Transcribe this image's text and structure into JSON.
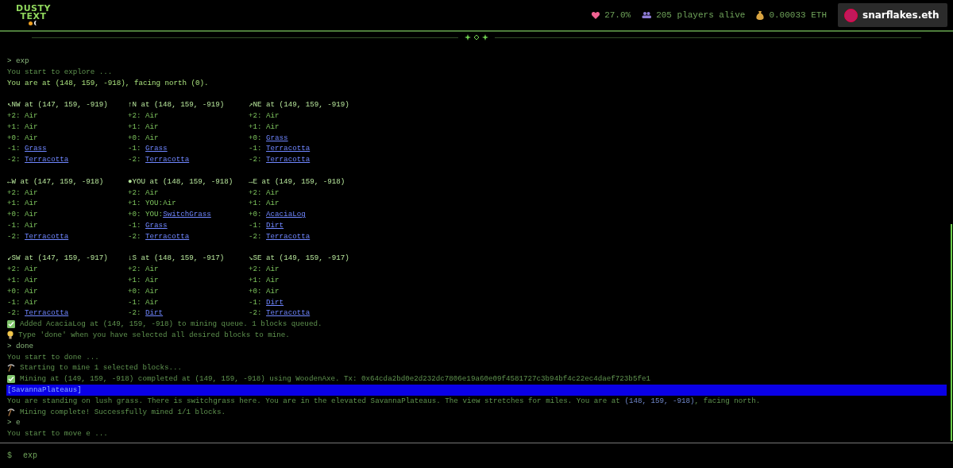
{
  "header": {
    "logo": {
      "line1": "DUSTY",
      "line2": "TEXT"
    },
    "stats": [
      {
        "kind": "health",
        "text": "27.0%"
      },
      {
        "kind": "players",
        "text": "205 players alive"
      },
      {
        "kind": "balance",
        "text": "0.00033 ETH"
      }
    ],
    "account": {
      "name": "snarflakes.eth"
    }
  },
  "log": [
    {
      "kind": "command",
      "text": "> exp"
    },
    {
      "kind": "info",
      "text": "You start to explore ..."
    },
    {
      "kind": "highlight",
      "text": "You are at (148, 159, -918), facing north (0)."
    },
    {
      "kind": "grid",
      "cells": [
        {
          "heading": "↖NW at (147, 159, -919)",
          "rows": [
            {
              "label": "+2:",
              "block": "Air",
              "link": false
            },
            {
              "label": "+1:",
              "block": "Air",
              "link": false
            },
            {
              "label": "+0:",
              "block": "Air",
              "link": false
            },
            {
              "label": "-1:",
              "block": "Grass",
              "link": true
            },
            {
              "label": "-2:",
              "block": "Terracotta",
              "link": true
            }
          ]
        },
        {
          "heading": "↑N at (148, 159, -919)",
          "rows": [
            {
              "label": "+2:",
              "block": "Air",
              "link": false
            },
            {
              "label": "+1:",
              "block": "Air",
              "link": false
            },
            {
              "label": "+0:",
              "block": "Air",
              "link": false
            },
            {
              "label": "-1:",
              "block": "Grass",
              "link": true
            },
            {
              "label": "-2:",
              "block": "Terracotta",
              "link": true
            }
          ]
        },
        {
          "heading": "↗NE at (149, 159, -919)",
          "rows": [
            {
              "label": "+2:",
              "block": "Air",
              "link": false
            },
            {
              "label": "+1:",
              "block": "Air",
              "link": false
            },
            {
              "label": "+0:",
              "block": "Grass",
              "link": true
            },
            {
              "label": "-1:",
              "block": "Terracotta",
              "link": true
            },
            {
              "label": "-2:",
              "block": "Terracotta",
              "link": true
            }
          ]
        },
        {
          "heading": "←W at (147, 159, -918)",
          "rows": [
            {
              "label": "+2:",
              "block": "Air",
              "link": false
            },
            {
              "label": "+1:",
              "block": "Air",
              "link": false
            },
            {
              "label": "+0:",
              "block": "Air",
              "link": false
            },
            {
              "label": "-1:",
              "block": "Air",
              "link": false
            },
            {
              "label": "-2:",
              "block": "Terracotta",
              "link": true
            }
          ]
        },
        {
          "heading": "●YOU at (148, 159, -918)",
          "rows": [
            {
              "label": "+2:",
              "block": "Air",
              "link": false
            },
            {
              "label": "+1:",
              "prefix": "YOU:",
              "block": "Air",
              "link": false
            },
            {
              "label": "+0:",
              "prefix": "YOU:",
              "block": "SwitchGrass",
              "link": true
            },
            {
              "label": "-1:",
              "block": "Grass",
              "link": true
            },
            {
              "label": "-2:",
              "block": "Terracotta",
              "link": true
            }
          ]
        },
        {
          "heading": "→E at (149, 159, -918)",
          "rows": [
            {
              "label": "+2:",
              "block": "Air",
              "link": false
            },
            {
              "label": "+1:",
              "block": "Air",
              "link": false
            },
            {
              "label": "+0:",
              "block": "AcaciaLog",
              "link": true
            },
            {
              "label": "-1:",
              "block": "Dirt",
              "link": true
            },
            {
              "label": "-2:",
              "block": "Terracotta",
              "link": true
            }
          ]
        },
        {
          "heading": "↙SW at (147, 159, -917)",
          "rows": [
            {
              "label": "+2:",
              "block": "Air",
              "link": false
            },
            {
              "label": "+1:",
              "block": "Air",
              "link": false
            },
            {
              "label": "+0:",
              "block": "Air",
              "link": false
            },
            {
              "label": "-1:",
              "block": "Air",
              "link": false
            },
            {
              "label": "-2:",
              "block": "Terracotta",
              "link": true
            }
          ]
        },
        {
          "heading": "↓S at (148, 159, -917)",
          "rows": [
            {
              "label": "+2:",
              "block": "Air",
              "link": false
            },
            {
              "label": "+1:",
              "block": "Air",
              "link": false
            },
            {
              "label": "+0:",
              "block": "Air",
              "link": false
            },
            {
              "label": "-1:",
              "block": "Air",
              "link": false
            },
            {
              "label": "-2:",
              "block": "Dirt",
              "link": true
            }
          ]
        },
        {
          "heading": "↘SE at (149, 159, -917)",
          "rows": [
            {
              "label": "+2:",
              "block": "Air",
              "link": false
            },
            {
              "label": "+1:",
              "block": "Air",
              "link": false
            },
            {
              "label": "+0:",
              "block": "Air",
              "link": false
            },
            {
              "label": "-1:",
              "block": "Dirt",
              "link": true
            },
            {
              "label": "-2:",
              "block": "Terracotta",
              "link": true
            }
          ]
        }
      ]
    },
    {
      "kind": "success",
      "text": "Added AcaciaLog at (149, 159, -918) to mining queue. 1 blocks queued."
    },
    {
      "kind": "hint",
      "text": "Type 'done' when you have selected all desired blocks to mine."
    },
    {
      "kind": "command",
      "text": "> done"
    },
    {
      "kind": "info",
      "text": "You start to done ..."
    },
    {
      "kind": "mining",
      "text": "Starting to mine 1 selected blocks..."
    },
    {
      "kind": "success",
      "text": "Mining at (149, 159, -918) completed at (149, 159, -918) using WoodenAxe. Tx: 0x64cda2bd0e2d232dc7806e19a60e09f4581727c3b94bf4c22ec4daef723b5fe1"
    },
    {
      "kind": "banner",
      "text": "[SavannaPlateaus]"
    },
    {
      "kind": "segments",
      "segments": [
        {
          "text": "You are standing on lush grass. There is switchgrass here. You are in the elevated SavannaPlateaus. The view stretches for miles. You are at ",
          "coords": false
        },
        {
          "text": "(148, 159, -918)",
          "coords": true
        },
        {
          "text": ", facing north.",
          "coords": false
        }
      ]
    },
    {
      "kind": "mining",
      "text": "Mining complete! Successfully mined 1/1 blocks."
    },
    {
      "kind": "command",
      "text": "> e"
    },
    {
      "kind": "info",
      "text": "You start to move e ..."
    }
  ],
  "input": {
    "prompt": "$",
    "value": "exp"
  }
}
